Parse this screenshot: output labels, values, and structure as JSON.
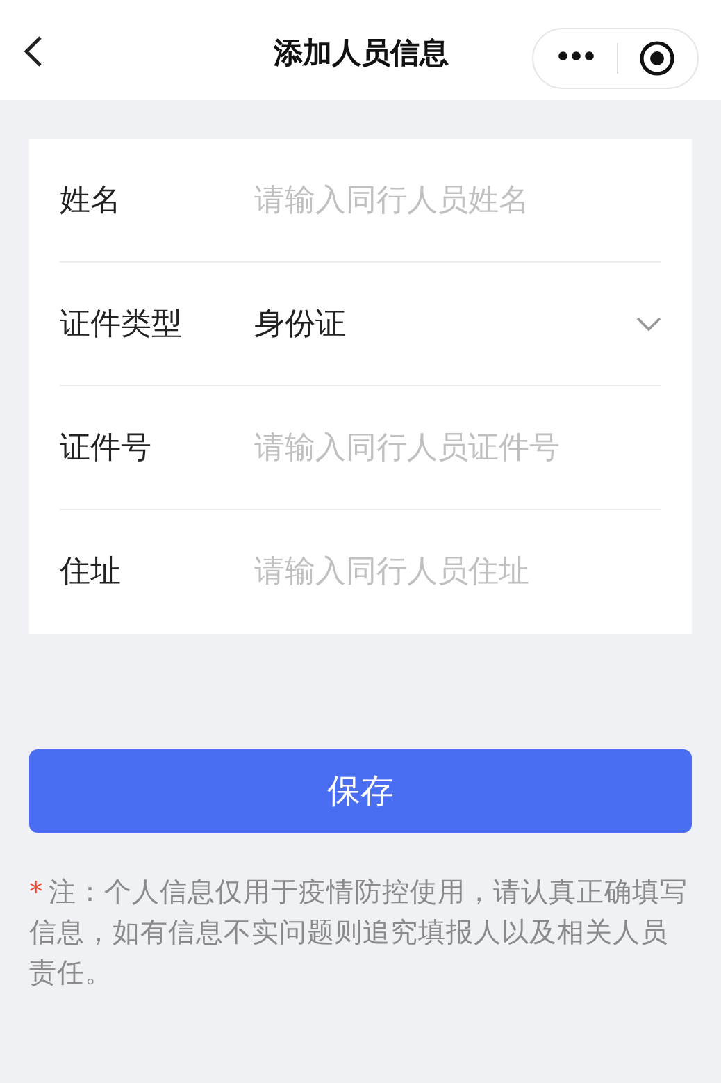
{
  "header": {
    "title": "添加人员信息",
    "more_button": "•••"
  },
  "form": {
    "fields": [
      {
        "kind": "input",
        "label": "姓名",
        "placeholder": "请输入同行人员姓名"
      },
      {
        "kind": "select",
        "label": "证件类型",
        "value": "身份证"
      },
      {
        "kind": "input",
        "label": "证件号",
        "placeholder": "请输入同行人员证件号"
      },
      {
        "kind": "input",
        "label": "住址",
        "placeholder": "请输入同行人员住址"
      }
    ]
  },
  "save_button": "保存",
  "note": {
    "mark": "*",
    "text": "注：个人信息仅用于疫情防控使用，请认真正确填写信息，如有信息不实问题则追究填报人以及相关人员责任。"
  }
}
